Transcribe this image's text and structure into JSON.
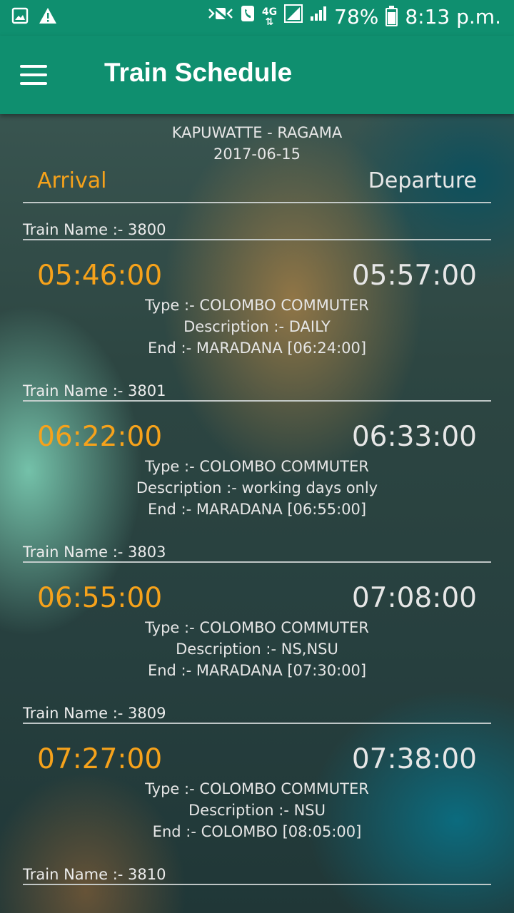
{
  "status_bar": {
    "battery": "78%",
    "time": "8:13 p.m.",
    "network": "4G",
    "icons": [
      "gallery-icon",
      "alert-icon",
      "mute-icon",
      "call-icon",
      "network-4g-icon",
      "signal-icon",
      "battery-icon"
    ]
  },
  "app_bar": {
    "title": "Train Schedule",
    "menu_icon": "menu-icon"
  },
  "header": {
    "route": "KAPUWATTE - RAGAMA",
    "date": "2017-06-15",
    "arrival_label": "Arrival",
    "departure_label": "Departure"
  },
  "colors": {
    "primary": "#0f8f6f",
    "accent": "#f6a21b",
    "text": "#e6e6e6"
  },
  "trains": [
    {
      "name": "Train Name :-   3800",
      "arrival": "05:46:00",
      "departure": "05:57:00",
      "type": "Type :- COLOMBO COMMUTER",
      "description": "Description :- DAILY",
      "end": "End :- MARADANA [06:24:00]"
    },
    {
      "name": "Train Name :-   3801",
      "arrival": "06:22:00",
      "departure": "06:33:00",
      "type": "Type :- COLOMBO COMMUTER",
      "description": "Description :- working days only",
      "end": "End :- MARADANA [06:55:00]"
    },
    {
      "name": "Train Name :-   3803",
      "arrival": "06:55:00",
      "departure": "07:08:00",
      "type": "Type :- COLOMBO COMMUTER",
      "description": "Description :- NS,NSU",
      "end": "End :- MARADANA [07:30:00]"
    },
    {
      "name": "Train Name :-   3809",
      "arrival": "07:27:00",
      "departure": "07:38:00",
      "type": "Type :- COLOMBO COMMUTER",
      "description": "Description :- NSU",
      "end": "End :- COLOMBO [08:05:00]"
    },
    {
      "name": "Train Name :-   3810"
    }
  ]
}
